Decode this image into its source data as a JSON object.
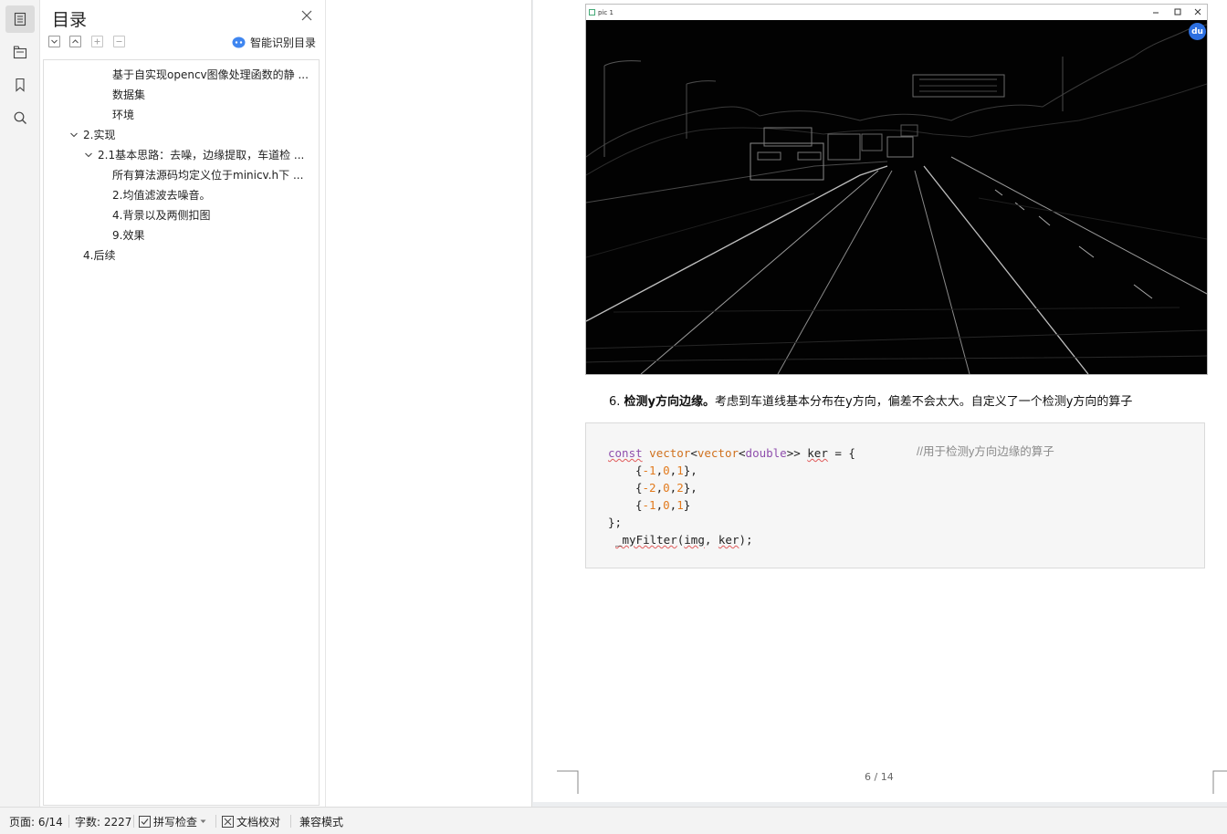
{
  "toc_panel": {
    "title": "目录",
    "smart_button_label": "智能识别目录",
    "items": [
      {
        "label": "基于自实现opencv图像处理函数的静 ...",
        "level": 3,
        "expandable": false
      },
      {
        "label": "数据集",
        "level": 3,
        "expandable": false
      },
      {
        "label": "环境",
        "level": 3,
        "expandable": false
      },
      {
        "label": "2.实现",
        "level": 1,
        "expandable": true
      },
      {
        "label": "2.1基本思路：去噪，边缘提取，车道检 ...",
        "level": 2,
        "expandable": true
      },
      {
        "label": "所有算法源码均定义位于minicv.h下 ...",
        "level": 3,
        "expandable": false
      },
      {
        "label": "2.均值滤波去噪音。",
        "level": 3,
        "expandable": false
      },
      {
        "label": "4.背景以及两侧扣图",
        "level": 3,
        "expandable": false
      },
      {
        "label": "9.效果",
        "level": 3,
        "expandable": false
      },
      {
        "label": "4.后续",
        "level": 2,
        "expandable": false
      }
    ]
  },
  "document": {
    "image_window": {
      "title": "pic 1",
      "badge": "du"
    },
    "step": {
      "number": "6.",
      "bold_text": "检测y方向边缘。",
      "text": "考虑到车道线基本分布在y方向，偏差不会太大。自定义了一个检测y方向的算子"
    },
    "code": {
      "line1_kw": "const",
      "line1_t1": "vector",
      "line1_t2": "vector",
      "line1_t3": "double",
      "line1_rest": ">> ",
      "line1_var": "ker",
      "line1_end": " = {",
      "comment": "//用于检测y方向边缘的算子",
      "rows": [
        [
          "-1",
          "0",
          "1"
        ],
        [
          "-2",
          "0",
          "2"
        ],
        [
          "-1",
          "0",
          "1"
        ]
      ],
      "close": "};",
      "call_fn": "_myFilter",
      "call_arg1": "img",
      "call_arg2": "ker",
      "call_tail": ");"
    },
    "page_number": "6 / 14"
  },
  "status_bar": {
    "page": "页面: 6/14",
    "word_count": "字数: 2227",
    "spell_check": "拼写检查",
    "proofread": "文档校对",
    "compat_mode": "兼容模式"
  },
  "colors": {
    "accent_blue": "#2c6fe0",
    "code_keyword": "#8f4fad",
    "code_number": "#e27a1d"
  }
}
